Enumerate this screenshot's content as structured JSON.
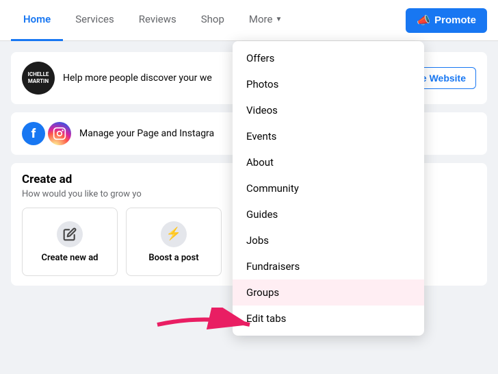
{
  "navbar": {
    "tabs": [
      {
        "label": "Home",
        "active": true
      },
      {
        "label": "Services",
        "active": false
      },
      {
        "label": "Reviews",
        "active": false
      },
      {
        "label": "Shop",
        "active": false
      },
      {
        "label": "More",
        "active": false,
        "hasChevron": true
      }
    ],
    "promote_label": "Promote",
    "promote_icon": "📣"
  },
  "promote_section": {
    "avatar_text": "ICHELLE\nMARTIN",
    "text": "Help more people discover your we",
    "button_label": "Promote Website"
  },
  "manage_section": {
    "text": "Manage your Page and Instagra"
  },
  "create_ad_section": {
    "title": "Create ad",
    "subtitle": "How would you like to grow yo",
    "cards": [
      {
        "label": "Create new ad",
        "icon": "✏️"
      },
      {
        "label": "Boost a post",
        "icon": "⚡"
      }
    ]
  },
  "dropdown": {
    "items": [
      {
        "label": "Offers",
        "highlighted": false
      },
      {
        "label": "Photos",
        "highlighted": false
      },
      {
        "label": "Videos",
        "highlighted": false
      },
      {
        "label": "Events",
        "highlighted": false
      },
      {
        "label": "About",
        "highlighted": false
      },
      {
        "label": "Community",
        "highlighted": false
      },
      {
        "label": "Guides",
        "highlighted": false
      },
      {
        "label": "Jobs",
        "highlighted": false
      },
      {
        "label": "Fundraisers",
        "highlighted": false
      },
      {
        "label": "Groups",
        "highlighted": true
      },
      {
        "label": "Edit tabs",
        "highlighted": false
      }
    ]
  }
}
